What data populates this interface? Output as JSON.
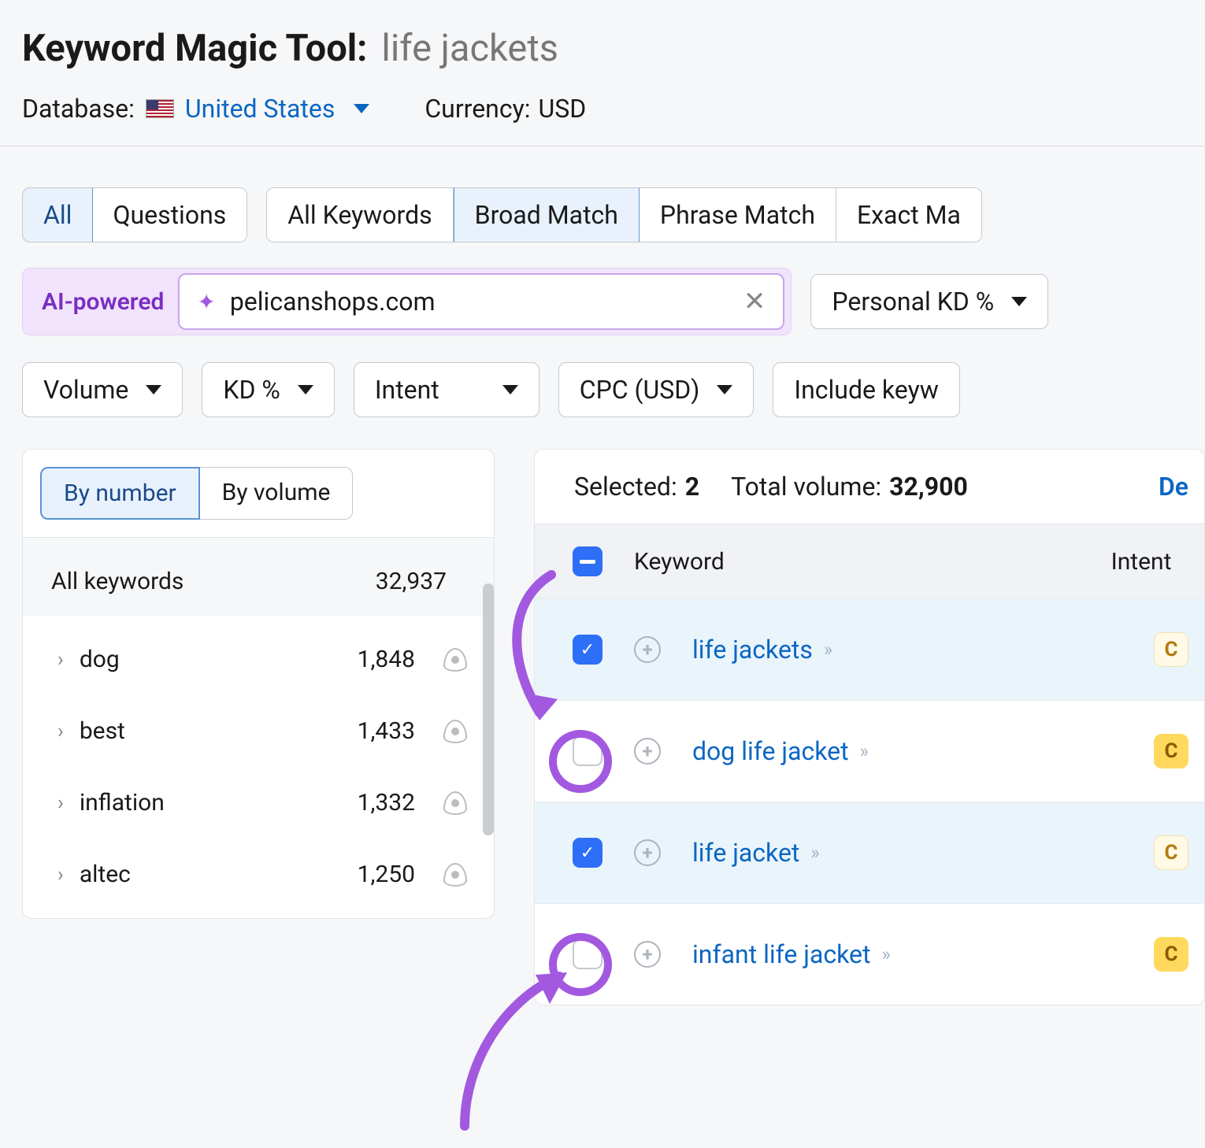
{
  "header": {
    "tool_title": "Keyword Magic Tool:",
    "query": "life jackets",
    "database_label": "Database:",
    "database_country": "United States",
    "currency_label": "Currency:",
    "currency_value": "USD"
  },
  "filter_tabs1": {
    "groupA": [
      "All",
      "Questions"
    ],
    "groupA_active": 0,
    "groupB": [
      "All Keywords",
      "Broad Match",
      "Phrase Match",
      "Exact Ma"
    ],
    "groupB_active": 1
  },
  "ai": {
    "label": "AI-powered",
    "domain": "pelicanshops.com",
    "pkd_label": "Personal KD %"
  },
  "filters2": [
    "Volume",
    "KD %",
    "Intent",
    "CPC (USD)",
    "Include keyw"
  ],
  "sidebar": {
    "tabs": [
      "By number",
      "By volume"
    ],
    "tabs_active": 0,
    "head_label": "All keywords",
    "head_count": "32,937",
    "items": [
      {
        "name": "dog",
        "count": "1,848"
      },
      {
        "name": "best",
        "count": "1,433"
      },
      {
        "name": "inflation",
        "count": "1,332"
      },
      {
        "name": "altec",
        "count": "1,250"
      }
    ]
  },
  "table": {
    "selected_label": "Selected:",
    "selected_count": "2",
    "totalvol_label": "Total volume:",
    "totalvol_value": "32,900",
    "action_label": "De",
    "col_keyword": "Keyword",
    "col_intent": "Intent",
    "rows": [
      {
        "keyword": "life jackets",
        "checked": true,
        "intent": "C",
        "intent_style": "light"
      },
      {
        "keyword": "dog life jacket",
        "checked": false,
        "intent": "C",
        "intent_style": "solid"
      },
      {
        "keyword": "life jacket",
        "checked": true,
        "intent": "C",
        "intent_style": "light"
      },
      {
        "keyword": "infant life jacket",
        "checked": false,
        "intent": "C",
        "intent_style": "solid"
      }
    ]
  }
}
